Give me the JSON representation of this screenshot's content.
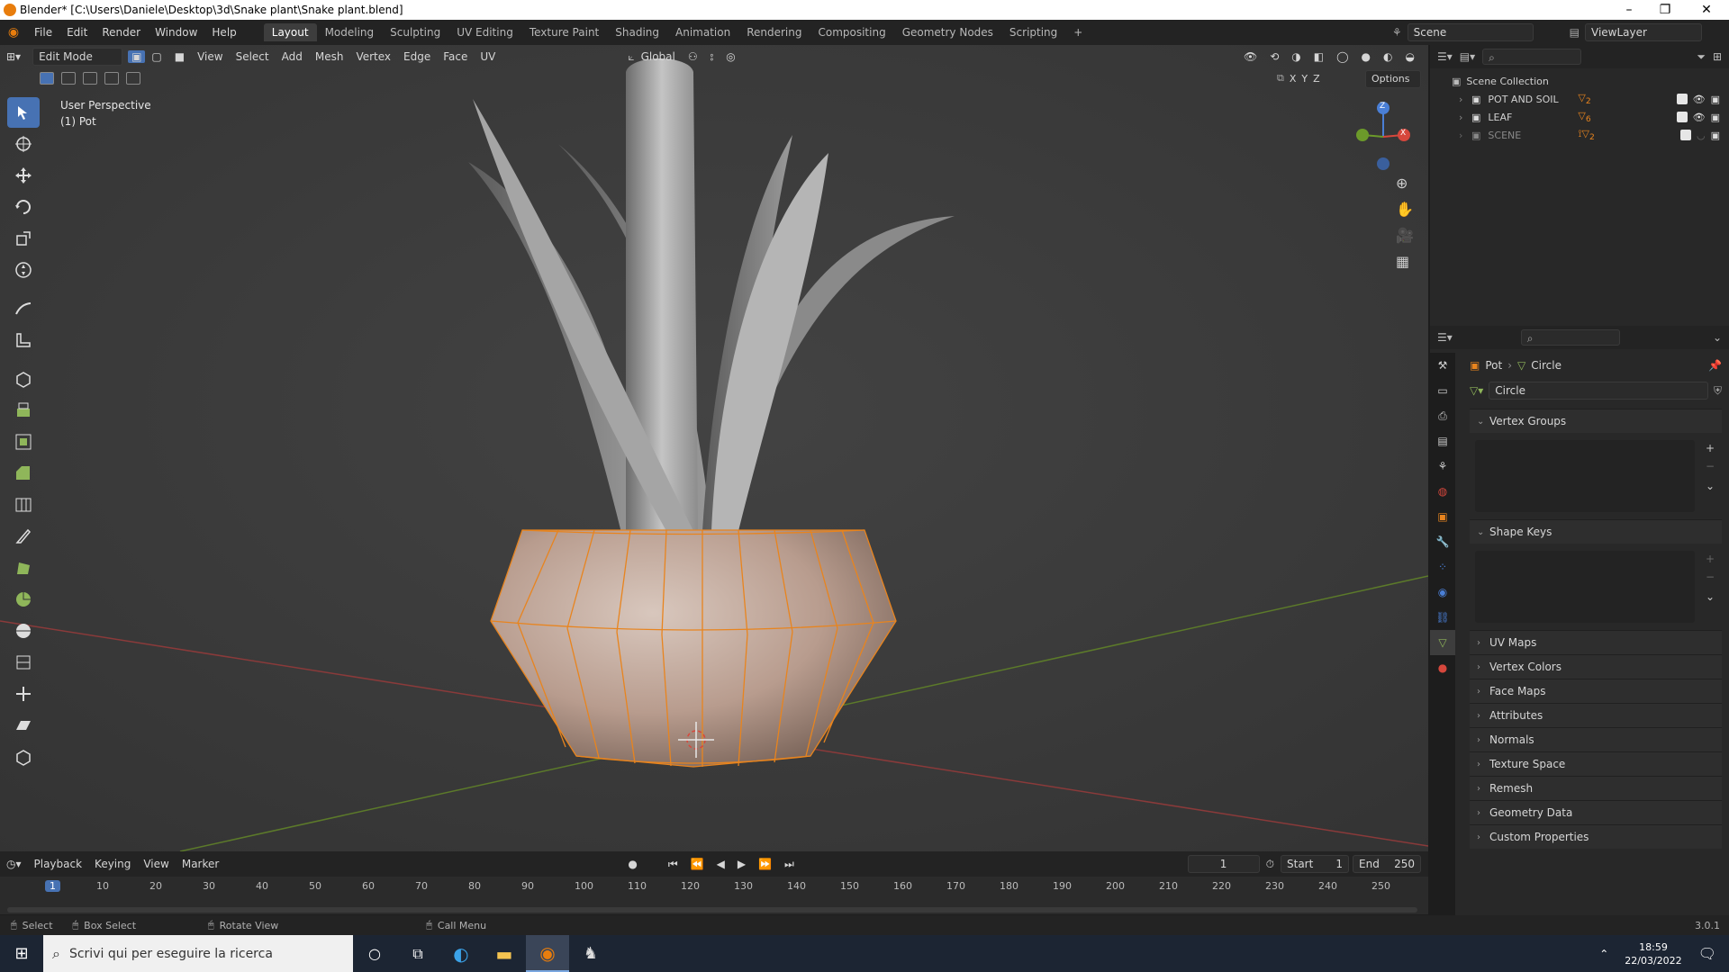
{
  "window": {
    "title": "Blender* [C:\\Users\\Daniele\\Desktop\\3d\\Snake plant\\Snake plant.blend]",
    "minimize": "–",
    "maximize": "❐",
    "close": "✕"
  },
  "menu": [
    "File",
    "Edit",
    "Render",
    "Window",
    "Help"
  ],
  "workspaces": [
    "Layout",
    "Modeling",
    "Sculpting",
    "UV Editing",
    "Texture Paint",
    "Shading",
    "Animation",
    "Rendering",
    "Compositing",
    "Geometry Nodes",
    "Scripting"
  ],
  "active_workspace": "Layout",
  "add_workspace": "+",
  "scene": {
    "name": "Scene",
    "viewlayer": "ViewLayer"
  },
  "viewport_header": {
    "mode": "Edit Mode",
    "menus": [
      "View",
      "Select",
      "Add",
      "Mesh",
      "Vertex",
      "Edge",
      "Face",
      "UV"
    ],
    "orientation": "Global",
    "options_label": "Options",
    "axes": [
      "X",
      "Y",
      "Z"
    ]
  },
  "viewport": {
    "perspective_label": "User Perspective",
    "object_label": "(1) Pot",
    "gizmo": {
      "z": "Z",
      "x": "X"
    }
  },
  "tools": [
    "select-box-icon",
    "cursor-icon",
    "move-icon",
    "rotate-icon",
    "scale-icon",
    "transform-icon",
    "annotate-icon",
    "measure-icon",
    "add-cube-icon",
    "extrude-icon",
    "inset-icon",
    "bevel-icon",
    "loop-cut-icon",
    "knife-icon",
    "poly-build-icon",
    "spin-icon",
    "smooth-icon",
    "edge-slide-icon",
    "shrink-fatten-icon",
    "shear-icon",
    "rip-icon"
  ],
  "outliner": {
    "root": "Scene Collection",
    "items": [
      {
        "name": "POT AND SOIL",
        "badge": "2"
      },
      {
        "name": "LEAF",
        "badge": "6"
      },
      {
        "name": "SCENE",
        "badge": "2"
      }
    ]
  },
  "properties": {
    "breadcrumb": {
      "object": "Pot",
      "data": "Circle"
    },
    "mesh_name": "Circle",
    "panels": {
      "vertex_groups": "Vertex Groups",
      "shape_keys": "Shape Keys",
      "collapsed": [
        "UV Maps",
        "Vertex Colors",
        "Face Maps",
        "Attributes",
        "Normals",
        "Texture Space",
        "Remesh",
        "Geometry Data",
        "Custom Properties"
      ]
    }
  },
  "timeline": {
    "menus": [
      "Playback",
      "Keying",
      "View",
      "Marker"
    ],
    "current_frame": "1",
    "start_label": "Start",
    "start": "1",
    "end_label": "End",
    "end": "250",
    "ticks": [
      "1",
      "10",
      "20",
      "30",
      "40",
      "50",
      "60",
      "70",
      "80",
      "90",
      "100",
      "110",
      "120",
      "130",
      "140",
      "150",
      "160",
      "170",
      "180",
      "190",
      "200",
      "210",
      "220",
      "230",
      "240",
      "250"
    ]
  },
  "statusbar": {
    "select": "Select",
    "box_select": "Box Select",
    "rotate_view": "Rotate View",
    "call_menu": "Call Menu",
    "version": "3.0.1"
  },
  "taskbar": {
    "search_placeholder": "Scrivi qui per eseguire la ricerca",
    "time": "18:59",
    "date": "22/03/2022"
  },
  "colors": {
    "accent": "#4772b3",
    "selection": "#f5872a",
    "viewport_bg": "#3d3d3d"
  }
}
